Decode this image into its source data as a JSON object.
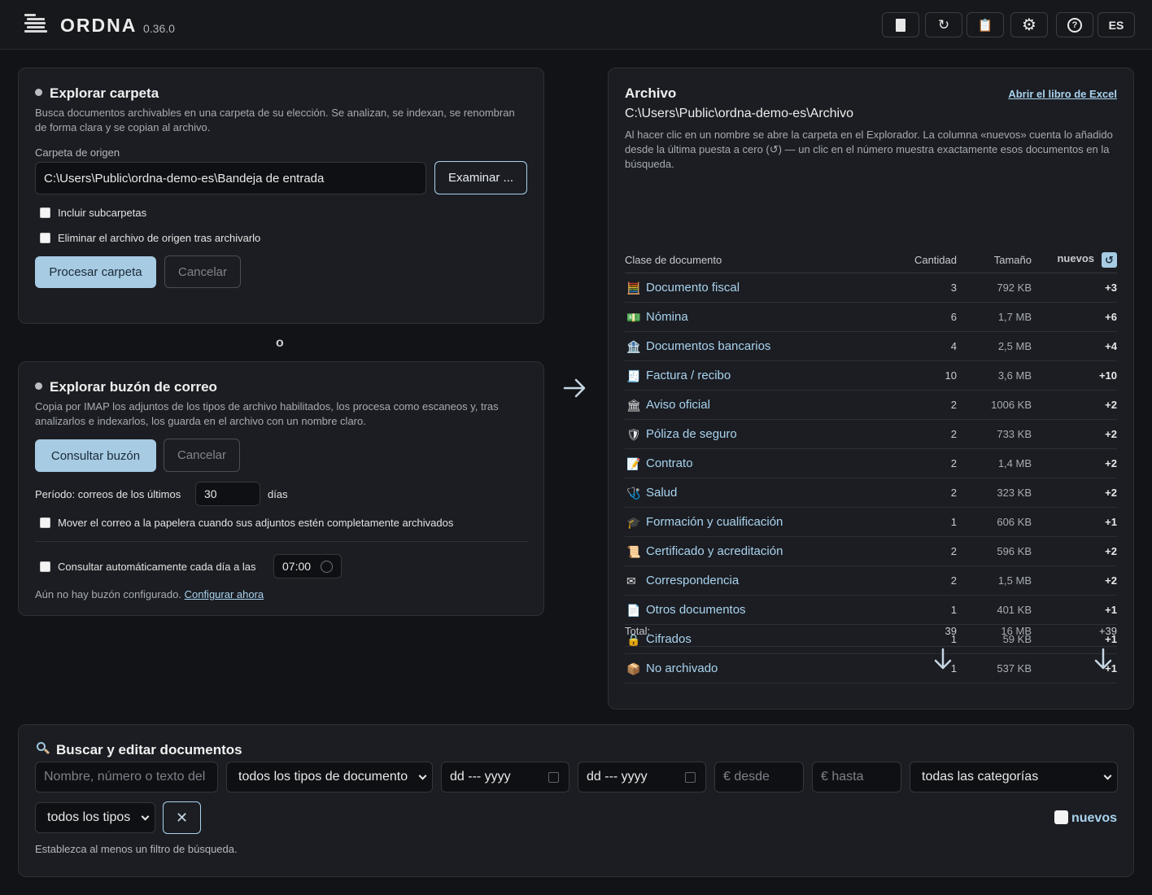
{
  "app": {
    "name": "ORDNA",
    "version": "0.36.0",
    "lang": "ES"
  },
  "toolbar": [
    {
      "name": "document-icon",
      "glyph": "▯"
    },
    {
      "name": "refresh-icon",
      "glyph": "↻"
    },
    {
      "name": "clipboard-icon",
      "glyph": "📋"
    },
    {
      "name": "gear-icon",
      "glyph": "⚙"
    },
    {
      "name": "help-icon",
      "glyph": "?"
    }
  ],
  "folder": {
    "title": "Explorar carpeta",
    "description": "Busca documentos archivables en una carpeta de su elección. Se analizan, se indexan, se renombran de forma clara y se copian al archivo.",
    "source_label": "Carpeta de origen",
    "source_value": "C:\\Users\\Public\\ordna-demo-es\\Bandeja de entrada",
    "browse": "Examinar ...",
    "include_sub": "Incluir subcarpetas",
    "delete_source": "Eliminar el archivo de origen tras archivarlo",
    "process": "Procesar carpeta",
    "cancel": "Cancelar"
  },
  "or_text": "o",
  "mail": {
    "title": "Explorar buzón de correo",
    "description": "Copia por IMAP los adjuntos de los tipos de archivo habilitados, los procesa como escaneos y, tras analizarlos e indexarlos, los guarda en el archivo con un nombre claro.",
    "check": "Consultar buzón",
    "cancel": "Cancelar",
    "period_label": "Período: correos de los últimos",
    "period_value": "30",
    "period_unit": "días",
    "trash": "Mover el correo a la papelera cuando sus adjuntos estén completamente archivados",
    "auto": "Consultar automáticamente cada día a las",
    "auto_time": "07:00",
    "not_configured": "Aún no hay buzón configurado.",
    "configure": "Configurar ahora"
  },
  "archive": {
    "title": "Archivo",
    "open_excel": "Abrir el libro de Excel",
    "path": "C:\\Users\\Public\\ordna-demo-es\\Archivo",
    "description": "Al hacer clic en un nombre se abre la carpeta en el Explorador. La columna «nuevos» cuenta lo añadido desde la última puesta a cero (↺) — un clic en el número muestra exactamente esos documentos en la búsqueda.",
    "headers": {
      "class": "Clase de documento",
      "qty": "Cantidad",
      "size": "Tamaño",
      "new": "nuevos"
    },
    "rows": [
      {
        "icon": "🧮",
        "icon_name": "abacus-icon",
        "name": "Documento fiscal",
        "qty": "3",
        "size": "792 KB",
        "new": "+3"
      },
      {
        "icon": "💵",
        "icon_name": "banknote-icon",
        "name": "Nómina",
        "qty": "6",
        "size": "1,7 MB",
        "new": "+6"
      },
      {
        "icon": "🏦",
        "icon_name": "bank-icon",
        "name": "Documentos bancarios",
        "qty": "4",
        "size": "2,5 MB",
        "new": "+4"
      },
      {
        "icon": "🧾",
        "icon_name": "receipt-icon",
        "name": "Factura / recibo",
        "qty": "10",
        "size": "3,6 MB",
        "new": "+10"
      },
      {
        "icon": "🏛",
        "icon_name": "government-building-icon",
        "name": "Aviso oficial",
        "qty": "2",
        "size": "1006 KB",
        "new": "+2"
      },
      {
        "icon": "🛡",
        "icon_name": "shield-icon",
        "name": "Póliza de seguro",
        "qty": "2",
        "size": "733 KB",
        "new": "+2"
      },
      {
        "icon": "📝",
        "icon_name": "memo-icon",
        "name": "Contrato",
        "qty": "2",
        "size": "1,4 MB",
        "new": "+2"
      },
      {
        "icon": "🩺",
        "icon_name": "stethoscope-icon",
        "name": "Salud",
        "qty": "2",
        "size": "323 KB",
        "new": "+2"
      },
      {
        "icon": "🎓",
        "icon_name": "graduation-cap-icon",
        "name": "Formación y cualificación",
        "qty": "1",
        "size": "606 KB",
        "new": "+1"
      },
      {
        "icon": "📜",
        "icon_name": "scroll-icon",
        "name": "Certificado y acreditación",
        "qty": "2",
        "size": "596 KB",
        "new": "+2"
      },
      {
        "icon": "✉",
        "icon_name": "envelope-icon",
        "name": "Correspondencia",
        "qty": "2",
        "size": "1,5 MB",
        "new": "+2"
      },
      {
        "icon": "📄",
        "icon_name": "page-icon",
        "name": "Otros documentos",
        "qty": "1",
        "size": "401 KB",
        "new": "+1"
      },
      {
        "icon": "🔒",
        "icon_name": "lock-icon",
        "name": "Cifrados",
        "qty": "1",
        "size": "59 KB",
        "new": "+1"
      },
      {
        "icon": "📦",
        "icon_name": "package-icon",
        "name": "No archivado",
        "qty": "1",
        "size": "537 KB",
        "new": "+1"
      }
    ],
    "total": {
      "label": "Total:",
      "qty": "39",
      "size": "16 MB",
      "new": "+39"
    }
  },
  "search": {
    "title": "Buscar y editar documentos",
    "text_placeholder": "Nombre, número o texto del",
    "doc_type": "todos los tipos de documento",
    "date_from": "dd --- yyyy",
    "date_to": "dd --- yyyy",
    "amount_from": "€ desde",
    "amount_to": "€ hasta",
    "category": "todas las categorías",
    "kind": "todos los tipos",
    "new_label": "nuevos",
    "hint": "Establezca al menos un filtro de búsqueda."
  },
  "colors": {
    "accent": "#a9d3ef",
    "primary_button": "#a6cbe3",
    "background": "#121316",
    "card": "#1b1d22"
  }
}
